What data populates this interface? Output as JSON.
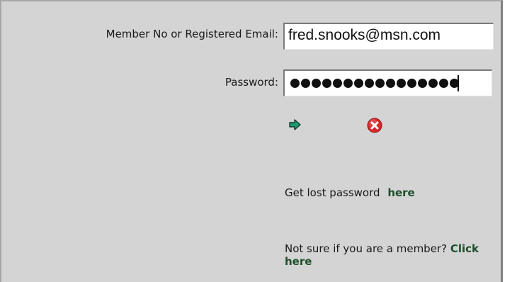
{
  "login_form": {
    "member_label": "Member No or Registered Email:",
    "member_value": "fred.snooks@msn.com",
    "password_label": "Password:",
    "password_length": 16,
    "submit_icon": "green-arrow-right-icon",
    "cancel_icon": "red-x-circle-icon",
    "lost_password_text": "Get lost password",
    "lost_password_link": "here",
    "member_check_text": "Not sure if you are a member?",
    "member_check_link": "Click here"
  },
  "colors": {
    "background": "#d4d4d4",
    "link": "#1f4f2c",
    "submit_arrow": "#1e9a72",
    "cancel_red": "#d7282b"
  }
}
